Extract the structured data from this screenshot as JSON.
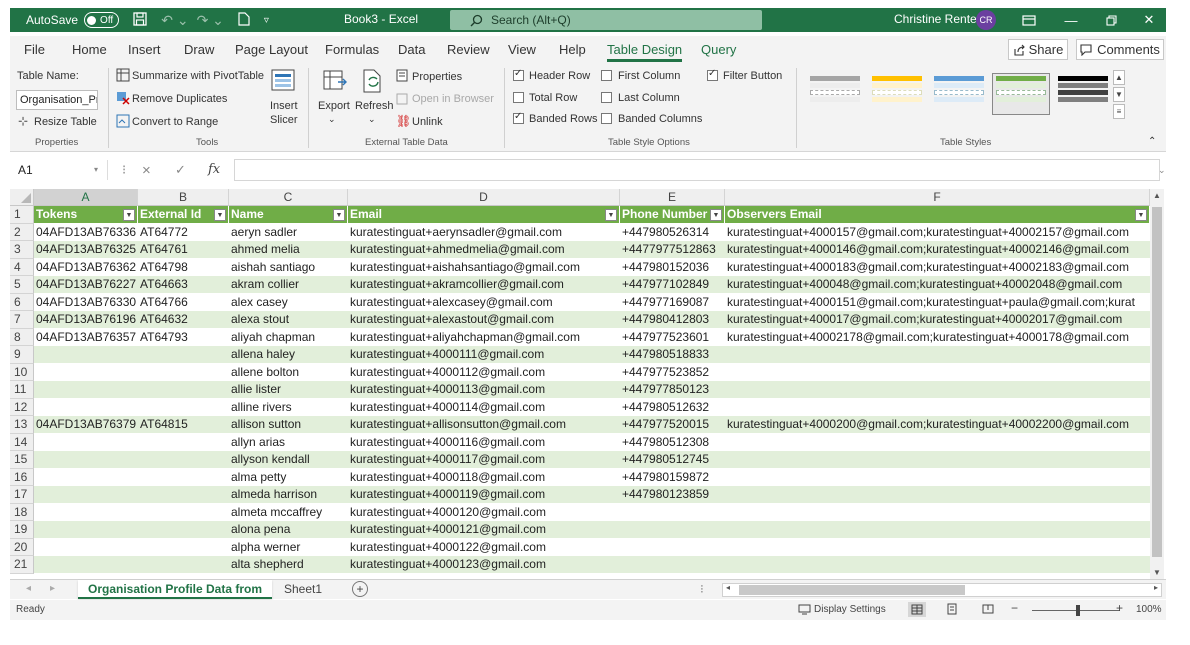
{
  "titlebar": {
    "autosave_label": "AutoSave",
    "autosave_state": "Off",
    "doc_title": "Book3 - Excel",
    "search_placeholder": "Search (Alt+Q)",
    "user_name": "Christine Rentel",
    "user_initials": "CR"
  },
  "menu": {
    "tabs": [
      "File",
      "Home",
      "Insert",
      "Draw",
      "Page Layout",
      "Formulas",
      "Data",
      "Review",
      "View",
      "Help",
      "Table Design",
      "Query"
    ],
    "active_tab": "Table Design",
    "share_label": "Share",
    "comments_label": "Comments"
  },
  "ribbon": {
    "table_name_label": "Table Name:",
    "table_name_value": "Organisation_Pro",
    "resize_table": "Resize Table",
    "properties_group": "Properties",
    "summarize_pivot": "Summarize with PivotTable",
    "remove_duplicates": "Remove Duplicates",
    "convert_to_range": "Convert to Range",
    "insert_label": "Insert",
    "slicer_label": "Slicer",
    "tools_group": "Tools",
    "export_label": "Export",
    "refresh_label": "Refresh",
    "properties_btn": "Properties",
    "open_in_browser": "Open in Browser",
    "unlink": "Unlink",
    "external_group": "External Table Data",
    "header_row": "Header Row",
    "total_row": "Total Row",
    "banded_rows": "Banded Rows",
    "first_column": "First Column",
    "last_column": "Last Column",
    "banded_columns": "Banded Columns",
    "filter_button": "Filter Button",
    "style_options_group": "Table Style Options",
    "table_styles_group": "Table Styles",
    "options_state": {
      "header_row": true,
      "total_row": false,
      "banded_rows": true,
      "first_column": false,
      "last_column": false,
      "banded_columns": false,
      "filter_button": true
    }
  },
  "formula": {
    "name_box": "A1",
    "cancel_symbol": "×",
    "enter_symbol": "✓",
    "fx_symbol": "fx"
  },
  "sheet": {
    "column_letters": [
      "A",
      "B",
      "C",
      "D",
      "E",
      "F"
    ],
    "selected_column": "A",
    "header_fill": "#70ad47",
    "band_fill": "#e2efda",
    "headers": [
      "Tokens",
      "External Id",
      "Name",
      "Email",
      "Phone Number",
      "Observers Email"
    ],
    "rows": [
      [
        "04AFD13AB76336",
        "AT64772",
        "aeryn sadler",
        "kuratestinguat+aerynsadler@gmail.com",
        "+447980526314",
        "kuratestinguat+4000157@gmail.com;kuratestinguat+40002157@gmail.com"
      ],
      [
        "04AFD13AB76325",
        "AT64761",
        "ahmed melia",
        "kuratestinguat+ahmedmelia@gmail.com",
        "+4477977512863",
        "kuratestinguat+4000146@gmail.com;kuratestinguat+40002146@gmail.com"
      ],
      [
        "04AFD13AB76362",
        "AT64798",
        "aishah santiago",
        "kuratestinguat+aishahsantiago@gmail.com",
        "+447980152036",
        "kuratestinguat+4000183@gmail.com;kuratestinguat+40002183@gmail.com"
      ],
      [
        "04AFD13AB76227",
        "AT64663",
        "akram collier",
        "kuratestinguat+akramcollier@gmail.com",
        "+447977102849",
        "kuratestinguat+400048@gmail.com;kuratestinguat+40002048@gmail.com"
      ],
      [
        "04AFD13AB76330",
        "AT64766",
        "alex casey",
        "kuratestinguat+alexcasey@gmail.com",
        "+447977169087",
        "kuratestinguat+4000151@gmail.com;kuratestinguat+paula@gmail.com;kurat"
      ],
      [
        "04AFD13AB76196",
        "AT64632",
        "alexa stout",
        "kuratestinguat+alexastout@gmail.com",
        "+447980412803",
        "kuratestinguat+400017@gmail.com;kuratestinguat+40002017@gmail.com"
      ],
      [
        "04AFD13AB76357",
        "AT64793",
        "aliyah chapman",
        "kuratestinguat+aliyahchapman@gmail.com",
        "+447977523601",
        "kuratestinguat+40002178@gmail.com;kuratestinguat+4000178@gmail.com"
      ],
      [
        "",
        "",
        "allena haley",
        "kuratestinguat+4000111@gmail.com",
        "+447980518833",
        ""
      ],
      [
        "",
        "",
        "allene bolton",
        "kuratestinguat+4000112@gmail.com",
        "+447977523852",
        ""
      ],
      [
        "",
        "",
        "allie lister",
        "kuratestinguat+4000113@gmail.com",
        "+447977850123",
        ""
      ],
      [
        "",
        "",
        "alline rivers",
        "kuratestinguat+4000114@gmail.com",
        "+447980512632",
        ""
      ],
      [
        "04AFD13AB76379",
        "AT64815",
        "allison sutton",
        "kuratestinguat+allisonsutton@gmail.com",
        "+447977520015",
        "kuratestinguat+4000200@gmail.com;kuratestinguat+40002200@gmail.com"
      ],
      [
        "",
        "",
        "allyn arias",
        "kuratestinguat+4000116@gmail.com",
        "+447980512308",
        ""
      ],
      [
        "",
        "",
        "allyson kendall",
        "kuratestinguat+4000117@gmail.com",
        "+447980512745",
        ""
      ],
      [
        "",
        "",
        "alma petty",
        "kuratestinguat+4000118@gmail.com",
        "+447980159872",
        ""
      ],
      [
        "",
        "",
        "almeda harrison",
        "kuratestinguat+4000119@gmail.com",
        "+447980123859",
        ""
      ],
      [
        "",
        "",
        "almeta mccaffrey",
        "kuratestinguat+4000120@gmail.com",
        "",
        ""
      ],
      [
        "",
        "",
        "alona pena",
        "kuratestinguat+4000121@gmail.com",
        "",
        ""
      ],
      [
        "",
        "",
        "alpha werner",
        "kuratestinguat+4000122@gmail.com",
        "",
        ""
      ],
      [
        "",
        "",
        "alta shepherd",
        "kuratestinguat+4000123@gmail.com",
        "",
        ""
      ]
    ]
  },
  "sheets": {
    "active_tab": "Organisation Profile Data from",
    "other_tab": "Sheet1",
    "add_symbol": "+"
  },
  "status": {
    "ready": "Ready",
    "display_settings": "Display Settings",
    "zoom": "100%",
    "zoom_minus": "−",
    "zoom_plus": "+"
  }
}
